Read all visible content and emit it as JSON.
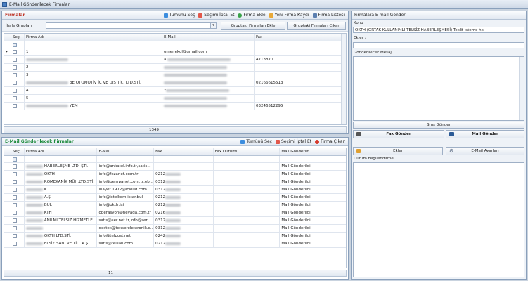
{
  "window": {
    "title": "E-Mail Gönderilecek Firmalar"
  },
  "firmalar": {
    "title": "Firmalar",
    "toolbar": {
      "select_all": "Tümünü Seç",
      "deselect": "Seçimi İptal Et",
      "add_firm": "Firma Ekle",
      "new_firm": "Yeni Firma Kaydı",
      "firm_list": "Firma Listesi"
    },
    "ihale_label": "İhale Grupları",
    "add_group_btn": "Gruptaki Firmaları Ekle",
    "remove_group_btn": "Gruptaki Firmaları Çıkar",
    "columns": [
      "Seç",
      "Firma Adı",
      "E-Mail",
      "Fax"
    ],
    "rows": [
      {
        "name": "1",
        "email": "omer.ekol@gmail.com",
        "fax": ""
      },
      {
        "name": "",
        "email": "a.",
        "fax": "4713870"
      },
      {
        "name": "2",
        "email": "",
        "fax": ""
      },
      {
        "name": "3",
        "email": "",
        "fax": ""
      },
      {
        "name": "3E OTOMOTİV İÇ VE DIŞ TİC. LTD.ŞTİ.",
        "email": "",
        "fax": "02166615513"
      },
      {
        "name": "4",
        "email": "Y",
        "fax": ""
      },
      {
        "name": "5",
        "email": "",
        "fax": ""
      },
      {
        "name": "YEM",
        "email": "",
        "fax": "03246512295"
      }
    ],
    "footer_count": "1349"
  },
  "gonderilecek": {
    "title": "E-Mail Gönderilecek Firmalar",
    "toolbar": {
      "select_all": "Tümünü Seç",
      "deselect": "Seçimi İptal Et",
      "remove": "Firma Çıkar"
    },
    "columns": [
      "Seç",
      "Firma Adı",
      "E-Mail",
      "Fax",
      "Fax Durumu",
      "Mail Gönderim"
    ],
    "rows": [
      {
        "name": "HABERLEŞME LTD. ŞTİ.",
        "email": "info@ankatel.info.tr,satis...",
        "fax": "",
        "fax_status": "",
        "mail_status": "Mail Gönderildi"
      },
      {
        "name": "OKTH",
        "email": "info@fezanet.com.tr",
        "fax": "0212",
        "fax_status": "",
        "mail_status": "Mail Gönderildi"
      },
      {
        "name": "ROMEKANİK MÜH.LTD.ŞTİ.",
        "email": "info@gempanet.com.tr,eb...",
        "fax": "0312",
        "fax_status": "",
        "mail_status": "Mail Gönderildi"
      },
      {
        "name": "K",
        "email": "inayet.1972@icloud.com",
        "fax": "0312",
        "fax_status": "",
        "mail_status": "Mail Gönderildi"
      },
      {
        "name": "A.Ş.",
        "email": "info@istelkom.istanbul",
        "fax": "0212",
        "fax_status": "",
        "mail_status": "Mail Gönderildi"
      },
      {
        "name": "BUL",
        "email": "info@okth.ist",
        "fax": "0212",
        "fax_status": "",
        "mail_status": "Mail Gönderildi"
      },
      {
        "name": "KTH",
        "email": "operasyon@nevada.com.tr",
        "fax": "0216",
        "fax_status": "",
        "mail_status": "Mail Gönderildi"
      },
      {
        "name": "ANILMI TELSİZ HİZMETLE...",
        "email": "satis@ser.net.tr,info@ser...",
        "fax": "0312",
        "fax_status": "",
        "mail_status": "Mail Gönderildi"
      },
      {
        "name": "",
        "email": "destek@tekserelektronik.c...",
        "fax": "0312",
        "fax_status": "",
        "mail_status": "Mail Gönderildi"
      },
      {
        "name": "OKTH LTD.ŞTİ.",
        "email": "info@telpost.net",
        "fax": "0242",
        "fax_status": "",
        "mail_status": "Mail Gönderildi"
      },
      {
        "name": "ELSİZ SAN. VE TİC. A.Ş.",
        "email": "satis@telsan.com",
        "fax": "0212",
        "fax_status": "",
        "mail_status": "Mail Gönderildi"
      }
    ],
    "footer_count": "11"
  },
  "right": {
    "title": "Firmalara E-mail Gönder",
    "konu_label": "Konu",
    "konu_value": "OKTH (ORTAK KULLANIMLI TELSİZ HABERLEŞMESİ) Teklif İsteme hk.",
    "ekler_label": "Ekler :",
    "mesaj_label": "Gönderilecek Mesaj",
    "sms_btn": "Sms Gönder",
    "fax_btn": "Fax Gönder",
    "mail_btn": "Mail Gönder",
    "ekler_btn": "Ekler",
    "ayar_btn": "E-Mail Ayarları",
    "durum_label": "Durum Bilgilendirme"
  }
}
